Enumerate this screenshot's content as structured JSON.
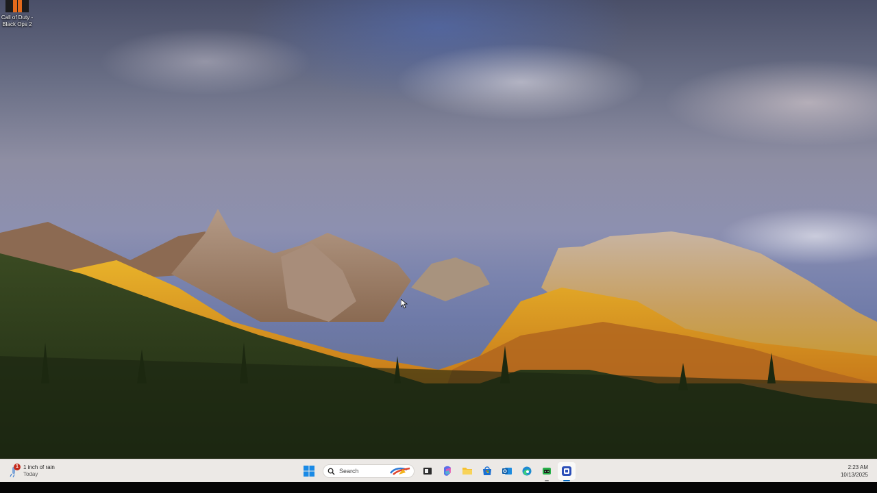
{
  "desktop": {
    "icons": [
      {
        "label": "Call of Duty - Black Ops 2",
        "icon": "black-ops-2-icon"
      }
    ]
  },
  "taskbar": {
    "weather": {
      "title": "1 inch of rain",
      "subtitle": "Today",
      "badge": "1",
      "icon": "rain-icon"
    },
    "search": {
      "placeholder": "Search",
      "icon": "search-icon"
    },
    "apps": [
      {
        "name": "start",
        "icon": "windows-start-icon"
      },
      {
        "name": "task-view",
        "icon": "task-view-icon"
      },
      {
        "name": "copilot",
        "icon": "copilot-icon"
      },
      {
        "name": "file-explorer",
        "icon": "folder-icon"
      },
      {
        "name": "microsoft-store",
        "icon": "store-icon"
      },
      {
        "name": "outlook",
        "icon": "outlook-icon"
      },
      {
        "name": "edge",
        "icon": "edge-icon"
      },
      {
        "name": "android-app",
        "icon": "android-icon"
      },
      {
        "name": "active-app",
        "icon": "app-icon"
      }
    ],
    "clock": {
      "time": "2:23 AM",
      "date": "10/13/2025"
    }
  },
  "colors": {
    "taskbar": "#ece9e6",
    "accent": "#0067c0",
    "badge": "#c42b1c"
  }
}
